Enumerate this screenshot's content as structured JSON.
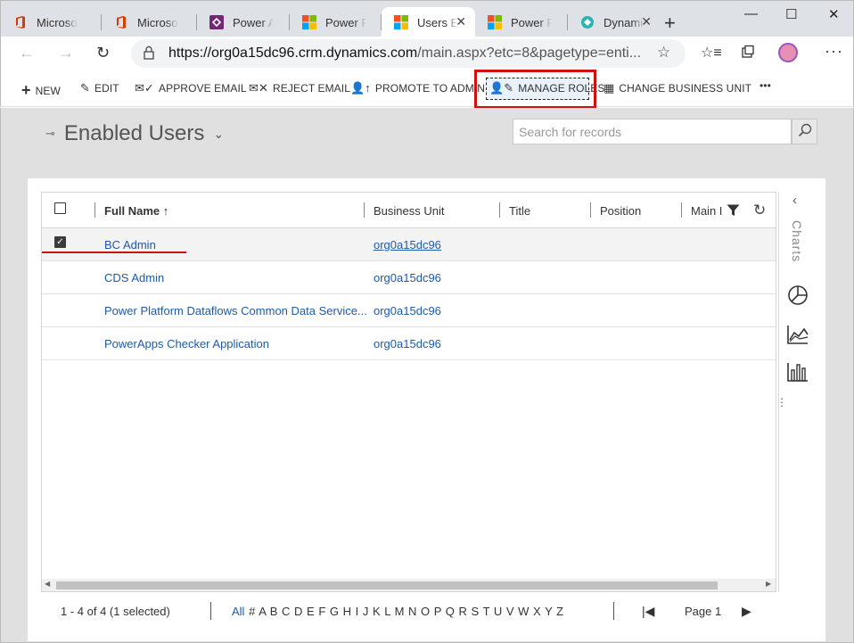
{
  "browser": {
    "tabs": [
      {
        "title": "Microsoft",
        "icon": "office-icon"
      },
      {
        "title": "Microsoft",
        "icon": "office-icon"
      },
      {
        "title": "Power Apps",
        "icon": "powerapps-icon"
      },
      {
        "title": "Power Platform",
        "icon": "microsoft-icon"
      },
      {
        "title": "Users Enabled",
        "icon": "microsoft-icon",
        "active": true
      },
      {
        "title": "Power Platform",
        "icon": "microsoft-icon"
      },
      {
        "title": "Dynamics",
        "icon": "dynamics-icon"
      }
    ],
    "url_host": "https://org0a15dc96.crm.dynamics.com",
    "url_path": "/main.aspx?etc=8&pagetype=enti..."
  },
  "commands": {
    "new": "NEW",
    "edit": "EDIT",
    "approve_email": "APPROVE EMAIL",
    "reject_email": "REJECT EMAIL",
    "promote_to_admin": "PROMOTE TO ADMIN",
    "manage_roles": "MANAGE ROLES",
    "change_business_unit": "CHANGE BUSINESS UNIT",
    "more": "•••"
  },
  "view": {
    "title": "Enabled Users",
    "search_placeholder": "Search for records"
  },
  "grid": {
    "columns": {
      "full_name": "Full Name ↑",
      "business_unit": "Business Unit",
      "title": "Title",
      "position": "Position",
      "main": "Main I"
    },
    "rows": [
      {
        "full_name": "BC Admin",
        "business_unit": "org0a15dc96",
        "selected": true
      },
      {
        "full_name": "CDS Admin",
        "business_unit": "org0a15dc96",
        "selected": false
      },
      {
        "full_name": "Power Platform Dataflows Common Data Service...",
        "business_unit": "org0a15dc96",
        "selected": false
      },
      {
        "full_name": "PowerApps Checker Application",
        "business_unit": "org0a15dc96",
        "selected": false
      }
    ]
  },
  "charts_label": "Charts",
  "footer": {
    "record_count": "1 - 4 of 4 (1 selected)",
    "all": "All",
    "letters": "# A B C D E F G H I J K L M N O P Q R S T U V W X Y Z",
    "page": "Page 1"
  },
  "colors": {
    "link": "#1d5ba8",
    "highlight": "#d21010",
    "band": "#e0e0e0"
  }
}
